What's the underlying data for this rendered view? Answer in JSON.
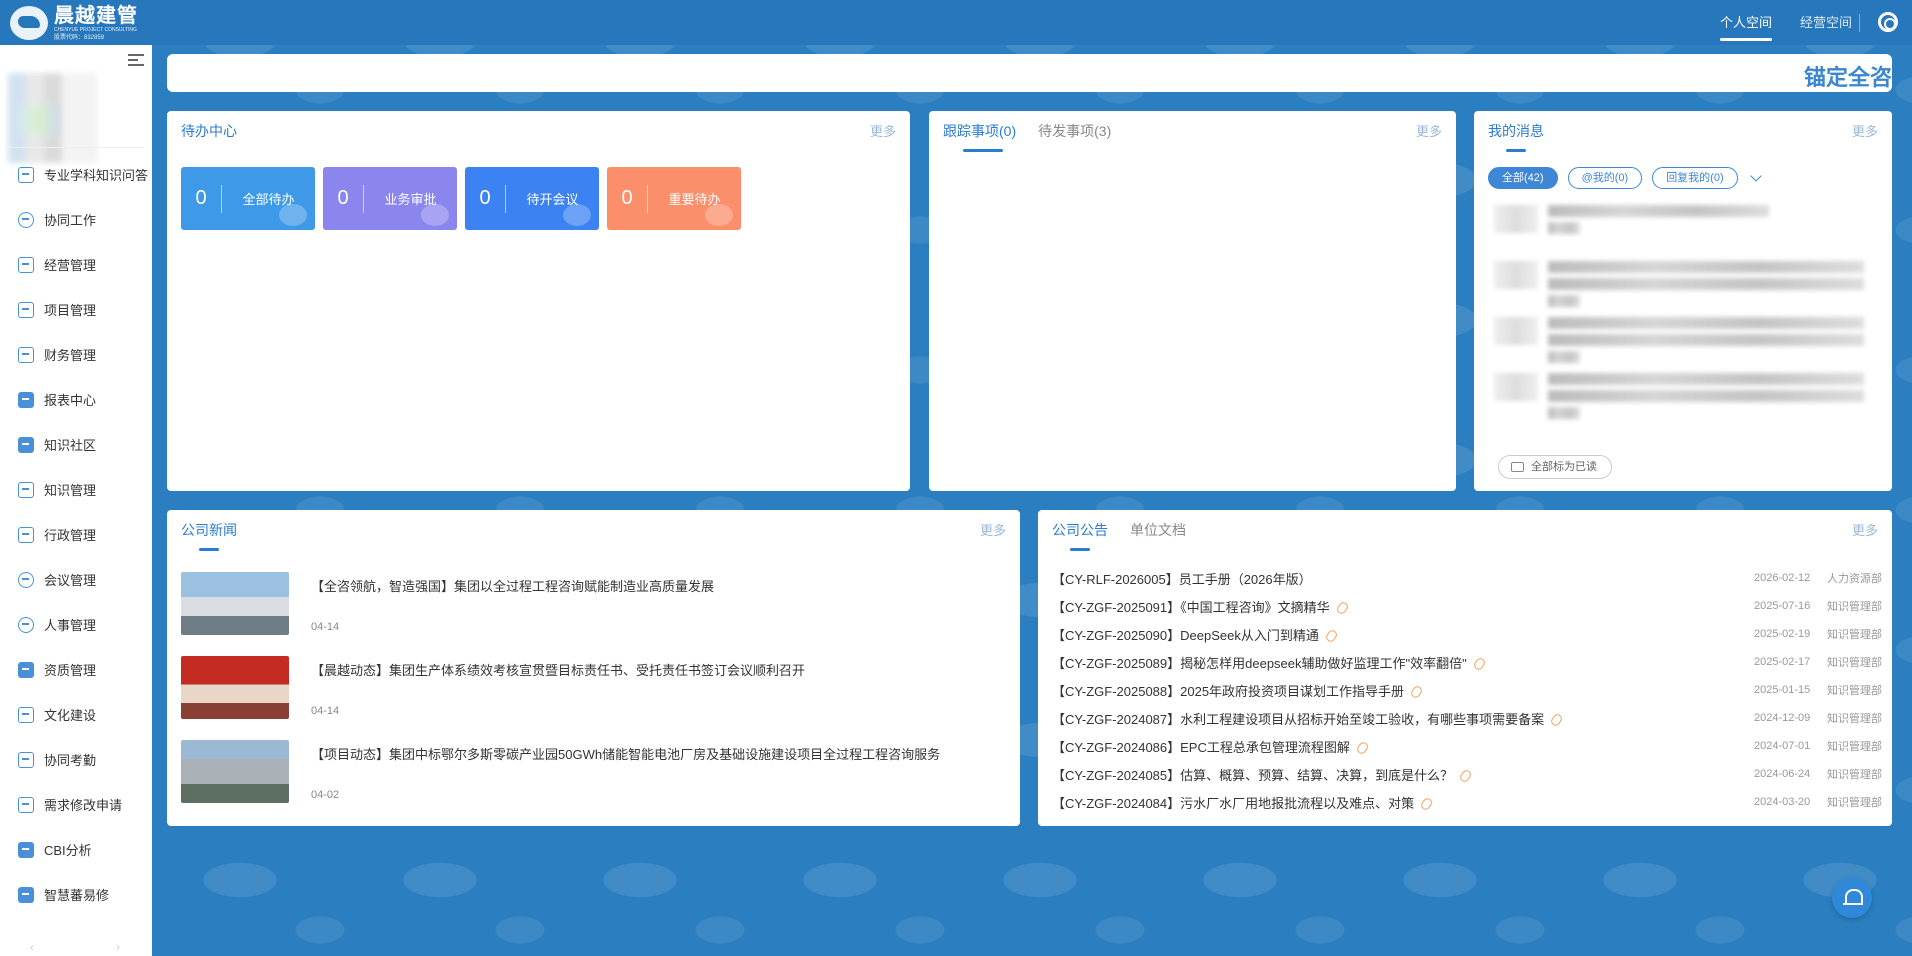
{
  "header": {
    "logo_cn": "晨越建管",
    "logo_en": "CHENYUE PROJECT CONSULTING",
    "logo_code": "股票代码：832859",
    "tabs": [
      "个人空间",
      "经营空间"
    ]
  },
  "sidebar": {
    "items": [
      {
        "label": "专业学科知识问答",
        "icon": "book-icon"
      },
      {
        "label": "协同工作",
        "icon": "share-icon"
      },
      {
        "label": "经营管理",
        "icon": "doc-icon"
      },
      {
        "label": "项目管理",
        "icon": "clipboard-icon"
      },
      {
        "label": "财务管理",
        "icon": "wallet-icon"
      },
      {
        "label": "报表中心",
        "icon": "chart-icon"
      },
      {
        "label": "知识社区",
        "icon": "graduation-icon"
      },
      {
        "label": "知识管理",
        "icon": "archive-icon"
      },
      {
        "label": "行政管理",
        "icon": "edit-icon"
      },
      {
        "label": "会议管理",
        "icon": "people-icon"
      },
      {
        "label": "人事管理",
        "icon": "user-icon"
      },
      {
        "label": "资质管理",
        "icon": "cube-icon"
      },
      {
        "label": "文化建设",
        "icon": "monitor-icon"
      },
      {
        "label": "协同考勤",
        "icon": "calendar-icon"
      },
      {
        "label": "需求修改申请",
        "icon": "home-icon"
      },
      {
        "label": "CBI分析",
        "icon": "file-icon"
      },
      {
        "label": "智慧蕃易修",
        "icon": "cube-icon"
      }
    ]
  },
  "banner": {
    "text": "锚定全咨"
  },
  "todo": {
    "title": "待办中心",
    "more": "更多",
    "tiles": [
      {
        "count": "0",
        "label": "全部待办"
      },
      {
        "count": "0",
        "label": "业务审批"
      },
      {
        "count": "0",
        "label": "待开会议"
      },
      {
        "count": "0",
        "label": "重要待办"
      }
    ]
  },
  "tracking": {
    "tabs": [
      "跟踪事项(0)",
      "待发事项(3)"
    ],
    "more": "更多"
  },
  "messages": {
    "title": "我的消息",
    "more": "更多",
    "filters": [
      "全部(42)",
      "@我的(0)",
      "回复我的(0)"
    ],
    "mark_all_read": "全部标为已读"
  },
  "news": {
    "title": "公司新闻",
    "more": "更多",
    "items": [
      {
        "title": "【全咨领航，智造强国】集团以全过程工程咨询赋能制造业高质量发展",
        "date": "04-14"
      },
      {
        "title": "【晨越动态】集团生产体系绩效考核宣贯暨目标责任书、受托责任书签订会议顺利召开",
        "date": "04-14"
      },
      {
        "title": "【项目动态】集团中标鄂尔多斯零碳产业园50GWh储能智能电池厂房及基础设施建设项目全过程工程咨询服务",
        "date": "04-02"
      }
    ]
  },
  "notices": {
    "tabs": [
      "公司公告",
      "单位文档"
    ],
    "more": "更多",
    "items": [
      {
        "title": "【CY-RLF-2026005】员工手册（2026年版）",
        "clip": false,
        "date": "2026-02-12",
        "dept": "人力资源部"
      },
      {
        "title": "【CY-ZGF-2025091】《中国工程咨询》文摘精华",
        "clip": true,
        "date": "2025-07-16",
        "dept": "知识管理部"
      },
      {
        "title": "【CY-ZGF-2025090】DeepSeek从入门到精通",
        "clip": true,
        "date": "2025-02-19",
        "dept": "知识管理部"
      },
      {
        "title": "【CY-ZGF-2025089】揭秘怎样用deepseek辅助做好监理工作\"效率翻倍\"",
        "clip": true,
        "date": "2025-02-17",
        "dept": "知识管理部"
      },
      {
        "title": "【CY-ZGF-2025088】2025年政府投资项目谋划工作指导手册",
        "clip": true,
        "date": "2025-01-15",
        "dept": "知识管理部"
      },
      {
        "title": "【CY-ZGF-2024087】水利工程建设项目从招标开始至竣工验收，有哪些事项需要备案",
        "clip": true,
        "date": "2024-12-09",
        "dept": "知识管理部"
      },
      {
        "title": "【CY-ZGF-2024086】EPC工程总承包管理流程图解",
        "clip": true,
        "date": "2024-07-01",
        "dept": "知识管理部"
      },
      {
        "title": "【CY-ZGF-2024085】估算、概算、预算、结算、决算，到底是什么？",
        "clip": true,
        "date": "2024-06-24",
        "dept": "知识管理部"
      },
      {
        "title": "【CY-ZGF-2024084】污水厂水厂用地报批流程以及难点、对策",
        "clip": true,
        "date": "2024-03-20",
        "dept": "知识管理部"
      }
    ]
  }
}
